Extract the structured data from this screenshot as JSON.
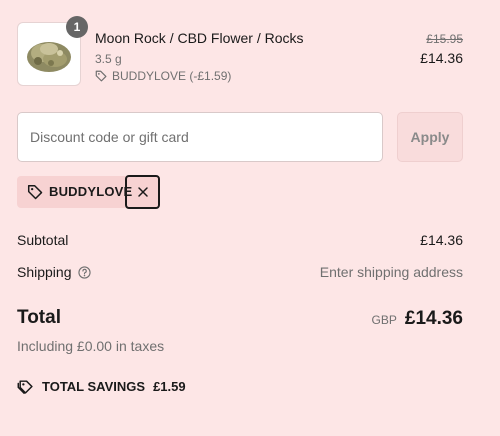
{
  "product": {
    "quantity": "1",
    "title": "Moon Rock / CBD Flower / Rocks",
    "variant": "3.5 g",
    "discount_line": "BUDDYLOVE (-£1.59)",
    "original_price": "£15.95",
    "price": "£14.36",
    "image_icon": "cbd-flower-image"
  },
  "discount": {
    "placeholder": "Discount code or gift card",
    "value": "",
    "apply_label": "Apply",
    "applied_code": "BUDDYLOVE"
  },
  "summary": {
    "subtotal_label": "Subtotal",
    "subtotal_value": "£14.36",
    "shipping_label": "Shipping",
    "shipping_value": "Enter shipping address",
    "total_label": "Total",
    "currency": "GBP",
    "total_value": "£14.36",
    "taxes_note": "Including £0.00 in taxes",
    "savings_label": "TOTAL SAVINGS",
    "savings_value": "£1.59"
  },
  "colors": {
    "background": "#fde6e6",
    "tag_background": "#f7d2d2",
    "text": "#1a1a1a",
    "muted": "#707070"
  }
}
